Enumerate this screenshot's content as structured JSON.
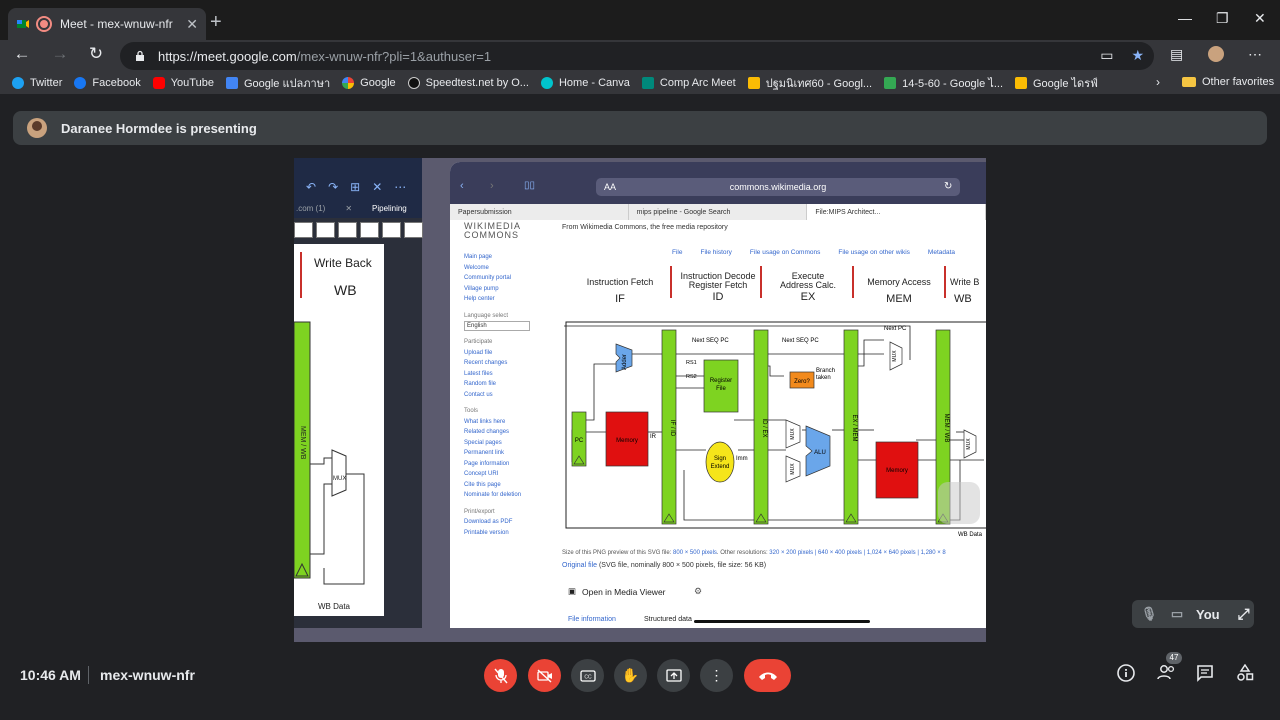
{
  "browser": {
    "tab_title": "Meet - mex-wnuw-nfr",
    "new_tab": "+",
    "url_host": "https://meet.google.com",
    "url_rest": "/mex-wnuw-nfr?pli=1&authuser=1",
    "window_controls": {
      "minimize": "—",
      "maximize": "❐",
      "close": "✕"
    },
    "bookmarks": [
      {
        "label": "Twitter",
        "color": "#1da1f2"
      },
      {
        "label": "Facebook",
        "color": "#1877f2"
      },
      {
        "label": "YouTube",
        "color": "#ff0000"
      },
      {
        "label": "Google แปลภาษา",
        "color": "#4285f4"
      },
      {
        "label": "Google",
        "color": "#ea4335"
      },
      {
        "label": "Speedtest.net by O...",
        "color": "#111111"
      },
      {
        "label": "Home - Canva",
        "color": "#00c4cc"
      },
      {
        "label": "Comp Arc Meet",
        "color": "#00897b"
      },
      {
        "label": "ปฐมนิเทศ60 - Googl...",
        "color": "#fbbc04"
      },
      {
        "label": "14-5-60 - Google ไ...",
        "color": "#34a853"
      },
      {
        "label": "Google ไดรฟ์",
        "color": "#fbbc04"
      }
    ],
    "other_favorites": "Other favorites"
  },
  "presenter": {
    "text": "Daranee Hormdee is presenting"
  },
  "left_app": {
    "tab_left": ".com (1)",
    "tab_right": "Pipelining",
    "stage_title": "Write Back",
    "stage_abbr": "WB",
    "reg_label": "MEM / WB",
    "mux": "MUX",
    "wb_data": "WB Data"
  },
  "ipad": {
    "aa": "AA",
    "url": "commons.wikimedia.org",
    "tabs": [
      "Papersubmission",
      "mips pipeline - Google Search",
      "File:MIPS Architect..."
    ],
    "sidebar": {
      "logo1": "WIKIMEDIA",
      "logo2": "COMMONS",
      "links1": [
        "Main page",
        "Welcome",
        "Community portal",
        "Village pump",
        "Help center"
      ],
      "lang_head": "Language select",
      "lang": "English",
      "participate": "Participate",
      "links2": [
        "Upload file",
        "Recent changes",
        "Latest files",
        "Random file",
        "Contact us"
      ],
      "tools": "Tools",
      "links3": [
        "What links here",
        "Related changes",
        "Special pages",
        "Permanent link",
        "Page information",
        "Concept URI",
        "Cite this page",
        "Nominate for deletion"
      ],
      "print": "Print/export",
      "links4": [
        "Download as PDF",
        "Printable version"
      ]
    },
    "main": {
      "from": "From Wikimedia Commons, the free media repository",
      "tabs": [
        "File",
        "File history",
        "File usage on Commons",
        "File usage on other wikis",
        "Metadata"
      ],
      "stages": [
        {
          "t1": "Instruction Fetch",
          "t2": "",
          "ab": "IF"
        },
        {
          "t1": "Instruction Decode",
          "t2": "Register Fetch",
          "ab": "ID"
        },
        {
          "t1": "Execute",
          "t2": "Address Calc.",
          "ab": "EX"
        },
        {
          "t1": "Memory Access",
          "t2": "",
          "ab": "MEM"
        },
        {
          "t1": "Write B",
          "t2": "",
          "ab": "WB"
        }
      ],
      "diagram": {
        "next_pc": "Next PC",
        "next_seq_pc_1": "Next SEQ PC",
        "next_seq_pc_2": "Next SEQ PC",
        "adder": "Adder",
        "pc": "PC",
        "memory": "Memory",
        "ir": "IR",
        "if_id": "IF / ID",
        "rs1": "RS1",
        "rs2": "RS2",
        "register_file_1": "Register",
        "register_file_2": "File",
        "sign_1": "Sign",
        "sign_2": "Extend",
        "imm": "Imm",
        "id_ex": "ID / EX",
        "zero": "Zero?",
        "branch_1": "Branch",
        "branch_2": "taken",
        "mux": "MUX",
        "alu": "ALU",
        "ex_mem": "EX / MEM",
        "data_memory": "Memory",
        "mem_wb": "MEM / WB",
        "wb_data": "WB Data"
      },
      "size_text": "Size of this PNG preview of this SVG file:",
      "size_link": "800 × 500 pixels",
      "other_res": "Other resolutions:",
      "res_links": "320 × 200 pixels | 640 × 400 pixels | 1,024 × 640 pixels | 1,280 × 8",
      "original_link": "Original file",
      "original_text": "(SVG file, nominally 800 × 500 pixels, file size: 56 KB)",
      "media_viewer": "Open in Media Viewer",
      "file_info": "File information",
      "structured": "Structured data"
    }
  },
  "self_tile": {
    "label": "You"
  },
  "meeting": {
    "time": "10:46 AM",
    "code": "mex-wnuw-nfr",
    "participants": "47"
  }
}
